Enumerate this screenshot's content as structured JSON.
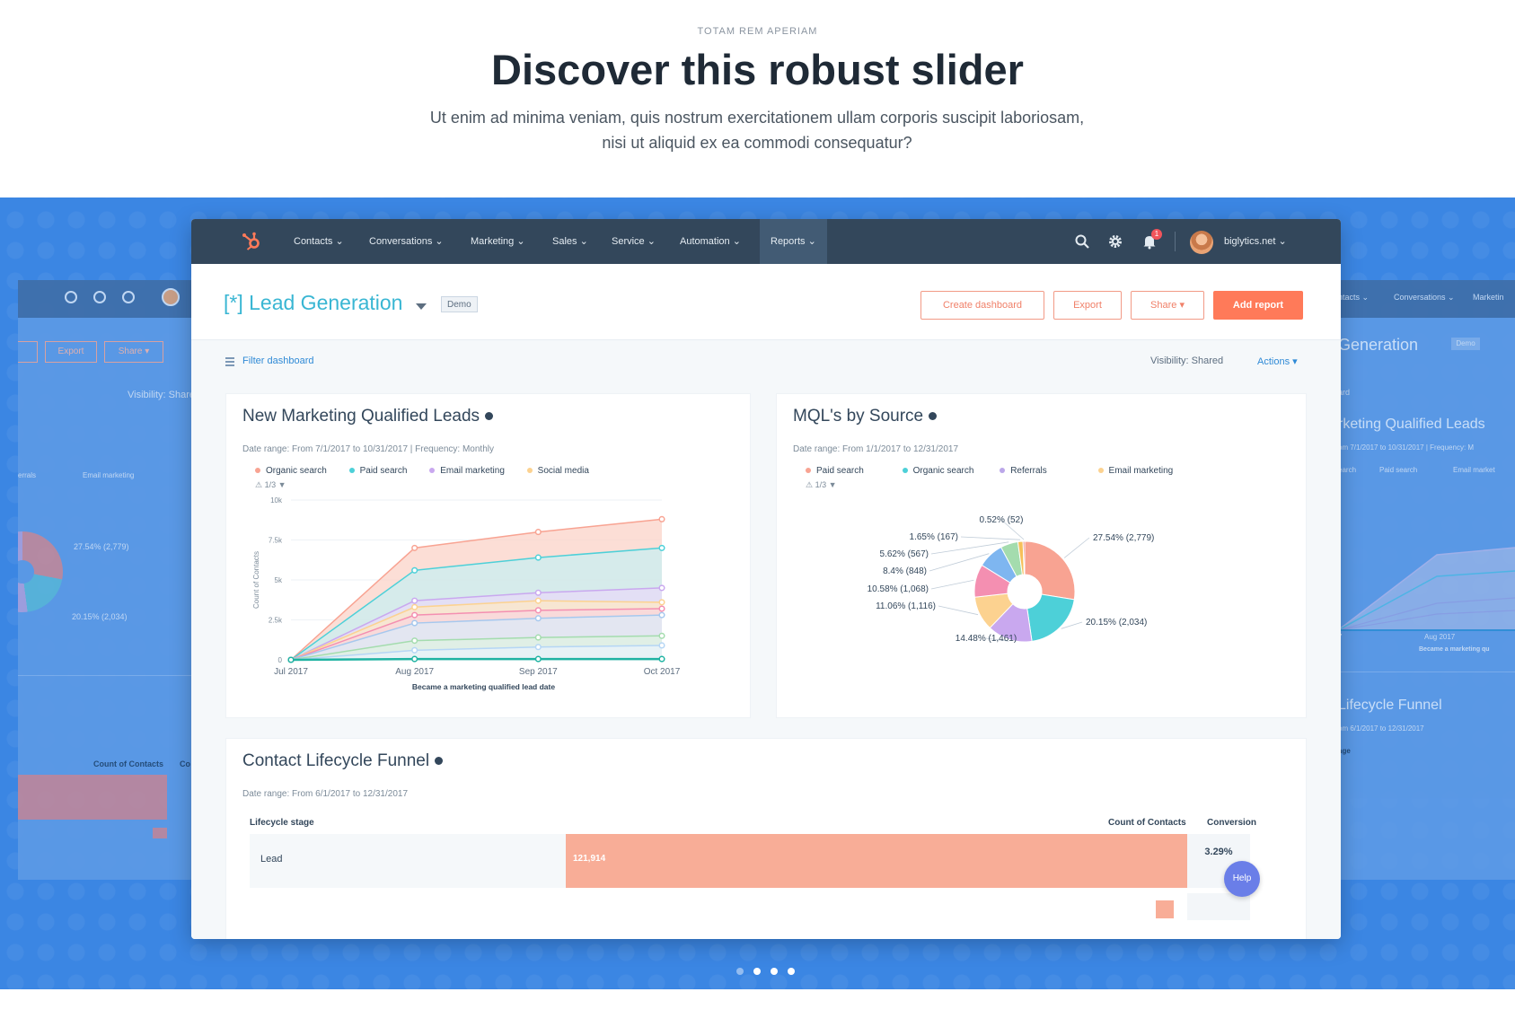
{
  "hero": {
    "eyebrow": "TOTAM REM APERIAM",
    "headline": "Discover this robust slider",
    "lede_line1": "Ut enim ad minima veniam, quis nostrum exercitationem ullam corporis suscipit laboriosam,",
    "lede_line2": "nisi ut aliquid ex ea commodi consequatur?"
  },
  "nav": {
    "items": [
      {
        "label": "Contacts ⌄"
      },
      {
        "label": "Conversations ⌄"
      },
      {
        "label": "Marketing ⌄"
      },
      {
        "label": "Sales ⌄"
      },
      {
        "label": "Service ⌄"
      },
      {
        "label": "Automation ⌄"
      },
      {
        "label": "Reports ⌄"
      }
    ],
    "notifications_count": "1",
    "account": "biglytics.net ⌄"
  },
  "dashboard": {
    "title": "[*] Lead Generation",
    "tag": "Demo",
    "buttons": {
      "create": "Create dashboard",
      "export": "Export",
      "share": "Share ▾",
      "add": "Add report"
    },
    "filter": "Filter dashboard",
    "visibility": "Visibility:  Shared",
    "actions": "Actions ▾"
  },
  "mql_panel": {
    "title": "New Marketing Qualified Leads",
    "meta": "Date range: From 7/1/2017 to 10/31/2017  |  Frequency: Monthly",
    "pager": "⚠ 1/3 ▼",
    "legend": [
      "Organic search",
      "Paid search",
      "Email marketing",
      "Social media"
    ]
  },
  "source_panel": {
    "title": "MQL's by Source",
    "meta": "Date range: From 1/1/2017 to 12/31/2017",
    "pager": "⚠ 1/3 ▼",
    "legend": [
      "Paid search",
      "Organic search",
      "Referrals",
      "Email marketing"
    ]
  },
  "funnel_panel": {
    "title": "Contact Lifecycle Funnel",
    "meta": "Date range: From 6/1/2017 to 12/31/2017",
    "col_stage": "Lifecycle stage",
    "col_count": "Count of Contacts",
    "col_conv": "Conversion",
    "rows": [
      {
        "stage": "Lead",
        "count": "121,914",
        "conversion": "3.29%"
      }
    ]
  },
  "help": "Help",
  "ghost_left": {
    "export": "Export",
    "share": "Share ▾",
    "visibility": "Visibility:  Share",
    "legend_a": "errals",
    "legend_b": "Email marketing",
    "pct_a": "27.54% (2,779)",
    "pct_b": "20.15% (2,034)",
    "count_label": "Count of Contacts",
    "col_cut": "Co"
  },
  "ghost_right": {
    "nav_a": "ntacts ⌄",
    "nav_b": "Conversations ⌄",
    "nav_c": "Marketin",
    "title": "Generation",
    "tag": "Demo",
    "filter": "ard",
    "panel_title": "rketing Qualified Leads",
    "meta": "om 7/1/2017 to 10/31/2017  |  Frequency: M",
    "legend_a": "earch",
    "legend_b": "Paid search",
    "legend_c": "Email market",
    "x_a": "7",
    "x_b": "Aug 2017",
    "x_title": "Became a marketing qu",
    "funnel_title": "Lifecycle Funnel",
    "funnel_meta": "om 6/1/2017 to 12/31/2017",
    "stage": "age"
  },
  "slider": {
    "count": 4,
    "active": 1
  },
  "colors": {
    "organic": "#f8a392",
    "paid": "#4dd0d8",
    "email": "#c9a8ef",
    "social": "#fcd290",
    "referrals": "#bba7e9",
    "nav": "#33475b",
    "accent": "#ff7a59",
    "stage": "#3b86e3"
  },
  "chart_data": [
    {
      "type": "area",
      "title": "New Marketing Qualified Leads",
      "xlabel": "Became a marketing qualified lead date",
      "ylabel": "Count of Contacts",
      "categories": [
        "Jul 2017",
        "Aug 2017",
        "Sep 2017",
        "Oct 2017"
      ],
      "yticks": [
        "0",
        "2.5k",
        "5k",
        "7.5k",
        "10k"
      ],
      "ylim": [
        0,
        10000
      ],
      "grid": true,
      "series": [
        {
          "name": "Organic search",
          "values": [
            0,
            7000,
            8000,
            8800
          ]
        },
        {
          "name": "Paid search",
          "values": [
            0,
            5600,
            6400,
            7000
          ]
        },
        {
          "name": "Email marketing",
          "values": [
            0,
            3700,
            4200,
            4500
          ]
        },
        {
          "name": "Social media",
          "values": [
            0,
            3300,
            3700,
            3600
          ]
        },
        {
          "name": "",
          "values": [
            0,
            2800,
            3100,
            3200
          ]
        },
        {
          "name": "",
          "values": [
            0,
            2300,
            2600,
            2800
          ]
        },
        {
          "name": "",
          "values": [
            0,
            1200,
            1400,
            1500
          ]
        },
        {
          "name": "",
          "values": [
            0,
            600,
            800,
            900
          ]
        },
        {
          "name": "",
          "values": [
            0,
            50,
            50,
            50
          ]
        }
      ]
    },
    {
      "type": "pie",
      "title": "MQL's by Source",
      "slices": [
        {
          "label": "27.54% (2,779)",
          "value": 27.54,
          "color": "#f8a392"
        },
        {
          "label": "20.15% (2,034)",
          "value": 20.15,
          "color": "#4dd0d8"
        },
        {
          "label": "14.48% (1,461)",
          "value": 14.48,
          "color": "#c9a8ef"
        },
        {
          "label": "11.06% (1,116)",
          "value": 11.06,
          "color": "#fcd290"
        },
        {
          "label": "10.58% (1,068)",
          "value": 10.58,
          "color": "#f48fb1"
        },
        {
          "label": "8.4% (848)",
          "value": 8.4,
          "color": "#7eb6f0"
        },
        {
          "label": "5.62% (567)",
          "value": 5.62,
          "color": "#a4dcae"
        },
        {
          "label": "1.65% (167)",
          "value": 1.65,
          "color": "#f6c05a"
        },
        {
          "label": "0.52% (52)",
          "value": 0.52,
          "color": "#e5736b"
        }
      ]
    }
  ]
}
